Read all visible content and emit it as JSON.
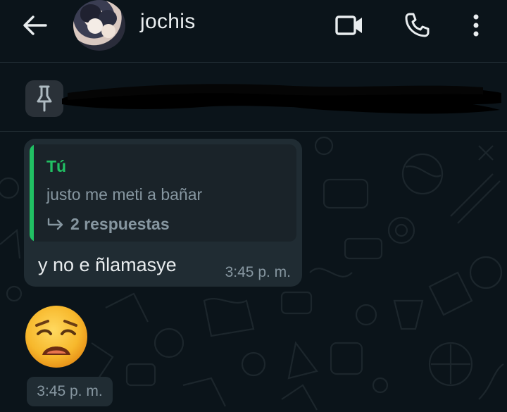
{
  "header": {
    "back_icon": "arrow-left-icon",
    "contact_name": "jochis",
    "video_icon": "video-camera-icon",
    "call_icon": "phone-icon",
    "menu_icon": "more-vertical-icon"
  },
  "pinned": {
    "icon": "pin-icon"
  },
  "messages": {
    "reply": {
      "quote_author": "Tú",
      "quote_text": "justo me meti a bañar",
      "quote_replies": "2 respuestas",
      "text": "y no e ñlamasye",
      "time": "3:45 p. m."
    },
    "emoji_message": {
      "emoji": "weary-face",
      "time": "3:45 p. m."
    }
  },
  "colors": {
    "background": "#0b141a",
    "bubble": "#202c33",
    "accent_green": "#21c063",
    "secondary_text": "#8696a0"
  }
}
